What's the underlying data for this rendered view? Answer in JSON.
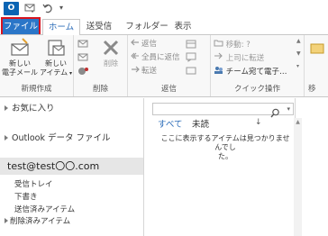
{
  "titlebar": {
    "app_icon_label": "O",
    "tabs": {
      "file": "ファイル",
      "home": "ホーム",
      "send_receive": "送受信",
      "folder": "フォルダー",
      "view": "表示"
    }
  },
  "ribbon": {
    "new": {
      "new_email_line1": "新しい",
      "new_email_line2": "電子メール",
      "new_items_line1": "新しい",
      "new_items_line2": "アイテム",
      "group_label": "新規作成"
    },
    "delete": {
      "delete_label": "削除",
      "group_label": "削除"
    },
    "respond": {
      "reply": "返信",
      "reply_all": "全員に返信",
      "forward": "転送",
      "group_label": "返信"
    },
    "quick_steps": {
      "move": "移動: ?",
      "to_manager": "上司に転送",
      "team_email": "チーム宛て電子…",
      "group_label": "クイック操作"
    },
    "move_group_label": "移"
  },
  "folder_pane": {
    "favorites": "お気に入り",
    "data_file": "Outlook データ ファイル",
    "account": "test@test〇〇.com",
    "folders": [
      "受信トレイ",
      "下書き",
      "送信済みアイテム",
      "削除済みアイテム"
    ]
  },
  "message_list": {
    "search_placeholder": "",
    "filter_all": "すべて",
    "filter_unread": "未読",
    "sort_indicator": "↓",
    "empty_line1": "ここに表示するアイテムは見つかりませんでし",
    "empty_line2": "た。"
  },
  "colors": {
    "accent": "#2b76c8",
    "highlight_border": "#d8141f"
  }
}
